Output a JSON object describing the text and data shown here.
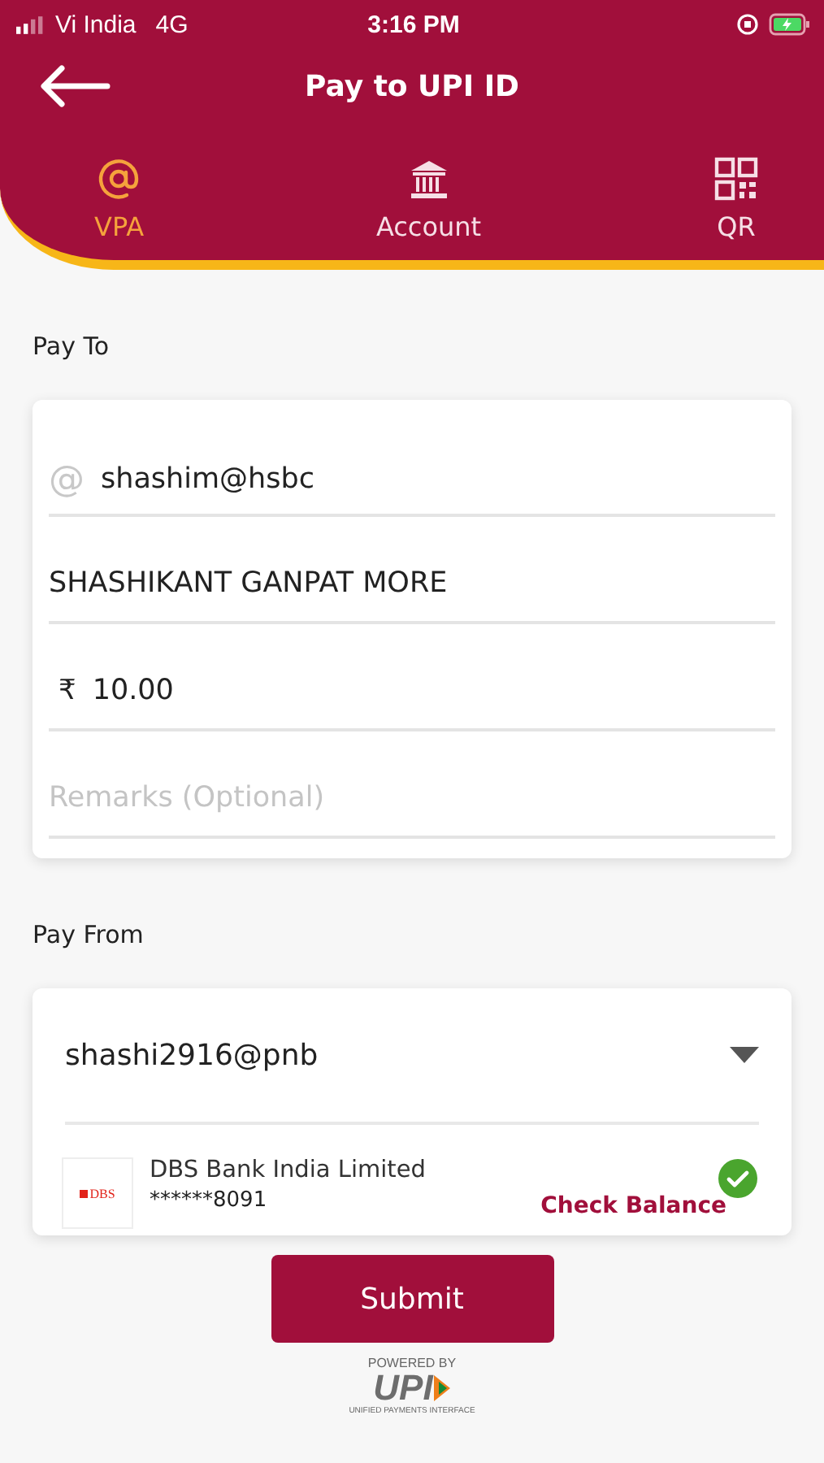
{
  "status_bar": {
    "carrier": "Vi India",
    "network": "4G",
    "time": "3:16 PM"
  },
  "header": {
    "title": "Pay to UPI ID"
  },
  "tabs": [
    {
      "label": "VPA",
      "kind": "at",
      "selected": true
    },
    {
      "label": "Account",
      "kind": "bank",
      "selected": false
    },
    {
      "label": "QR",
      "kind": "qr",
      "selected": false
    }
  ],
  "pay_to": {
    "label": "Pay To",
    "fields": [
      {
        "kind": "vpa",
        "prefix": "@",
        "value": "shashim@hsbc"
      },
      {
        "kind": "text",
        "value": "SHASHIKANT GANPAT MORE"
      },
      {
        "kind": "amount",
        "prefix": "₹",
        "value": "10.00"
      },
      {
        "kind": "text",
        "placeholder": "Remarks (Optional)"
      }
    ]
  },
  "pay_from": {
    "label": "Pay From",
    "upi_id": "shashi2916@pnb",
    "accounts": [
      {
        "logo": "DBS",
        "bank": "DBS Bank India Limited",
        "number": "******8091",
        "action": "Check Balance",
        "selected": true
      }
    ]
  },
  "submit": "Submit",
  "powered_by": {
    "caption": "POWERED BY",
    "logo": "UPI",
    "tagline": "UNIFIED PAYMENTS INTERFACE"
  }
}
